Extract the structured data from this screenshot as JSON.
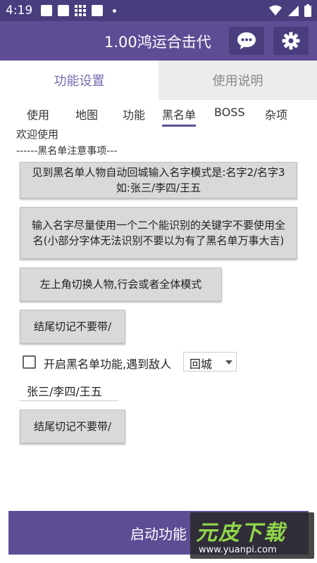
{
  "status_bar": {
    "time": "4:19"
  },
  "app_bar": {
    "title": "1.00鸿运合击代"
  },
  "top_tabs": [
    {
      "label": "功能设置"
    },
    {
      "label": "使用说明"
    }
  ],
  "sub_tabs": [
    {
      "label": "使用"
    },
    {
      "label": "地图"
    },
    {
      "label": "功能"
    },
    {
      "label": "黑名单"
    },
    {
      "label": "BOSS"
    },
    {
      "label": "杂项"
    }
  ],
  "active_sub_tab": "黑名单",
  "content": {
    "welcome": "欢迎使用",
    "notice_header": "------黑名单注意事项---",
    "btn_mode": "见到黑名单人物自动回城输入名字模式是:名字2/名字3如:张三/李四/王五",
    "btn_keyword": "输入名字尽量使用一个二个能识别的关键字不要使用全名(小部分字体无法识别不要以为有了黑名单万事大吉)",
    "btn_switch": "左上角切换人物,行会或者全体模式",
    "btn_no_slash_1": "结尾切记不要带/",
    "enable_label": "开启黑名单功能,遇到敌人",
    "enable_checked": false,
    "action_select": "回城",
    "name_input_value": "张三/李四/王五",
    "btn_no_slash_2": "结尾切记不要带/"
  },
  "start_button": "启动功能",
  "watermark": {
    "title": "元皮下载",
    "url": "www.yuanpi.com"
  }
}
